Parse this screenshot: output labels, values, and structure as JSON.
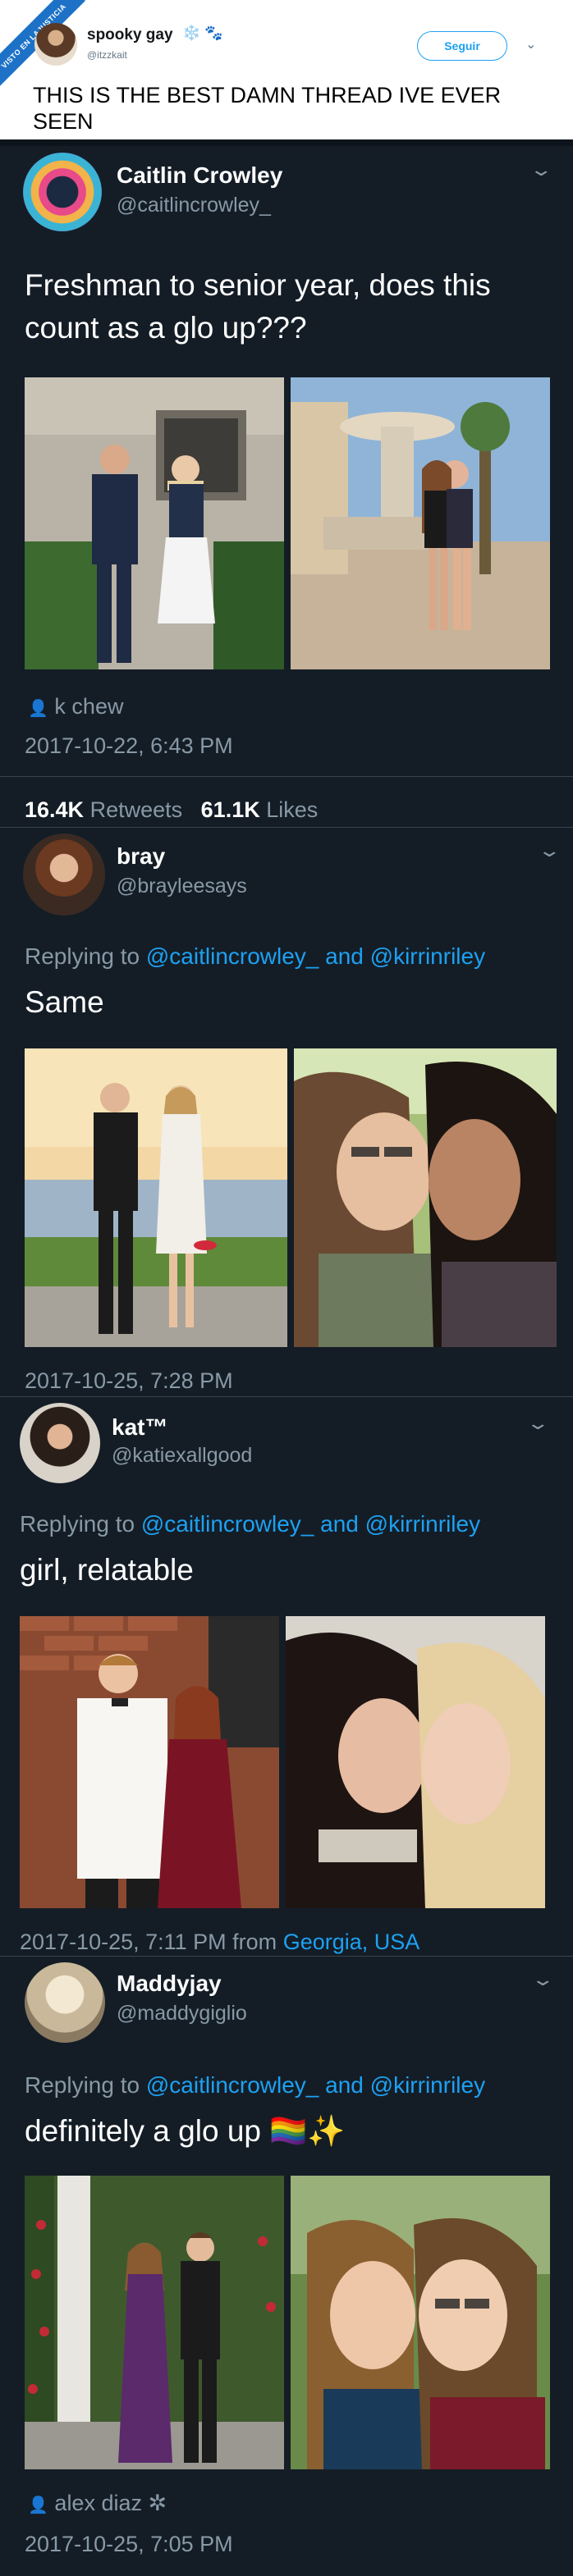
{
  "header": {
    "ribbon": "VISTO EN LAJUSTICIA",
    "name": "spooky gay",
    "emojis": "❄️ 🐾",
    "handle": "@itzzkait",
    "follow_label": "Seguir",
    "text": "THIS IS THE BEST DAMN THREAD IVE EVER SEEN"
  },
  "tweet1": {
    "name": "Caitlin Crowley",
    "handle": "@caitlincrowley_",
    "text": "Freshman to senior year, does this count as a glo up???",
    "tagged": "k chew",
    "timestamp": "2017-10-22, 6:43 PM",
    "retweets_count": "16.4K",
    "retweets_label": "Retweets",
    "likes_count": "61.1K",
    "likes_label": "Likes"
  },
  "tweet2": {
    "name": "bray",
    "handle": "@brayleesays",
    "replying_prefix": "Replying to",
    "mention1": "@caitlincrowley_",
    "and": "and",
    "mention2": "@kirrinriley",
    "text": "Same",
    "timestamp": "2017-10-25, 7:28 PM"
  },
  "tweet3": {
    "name": "kat™",
    "handle": "@katiexallgood",
    "replying_prefix": "Replying to",
    "mention1": "@caitlincrowley_",
    "and": "and",
    "mention2": "@kirrinriley",
    "text": "girl, relatable",
    "timestamp": "2017-10-25, 7:11 PM from",
    "location": "Georgia, USA"
  },
  "tweet4": {
    "name": "Maddyjay",
    "handle": "@maddygiglio",
    "replying_prefix": "Replying to",
    "mention1": "@caitlincrowley_",
    "and": "and",
    "mention2": "@kirrinriley",
    "text": "definitely a glo up 🏳️‍🌈✨",
    "tagged": "alex diaz ✲",
    "timestamp": "2017-10-25, 7:05 PM"
  },
  "icons": {
    "chevron": "chevron-down-icon",
    "person": "person-icon"
  },
  "colors": {
    "thread_bg": "#141d26",
    "link": "#1da1f2",
    "muted": "#8899a6"
  }
}
